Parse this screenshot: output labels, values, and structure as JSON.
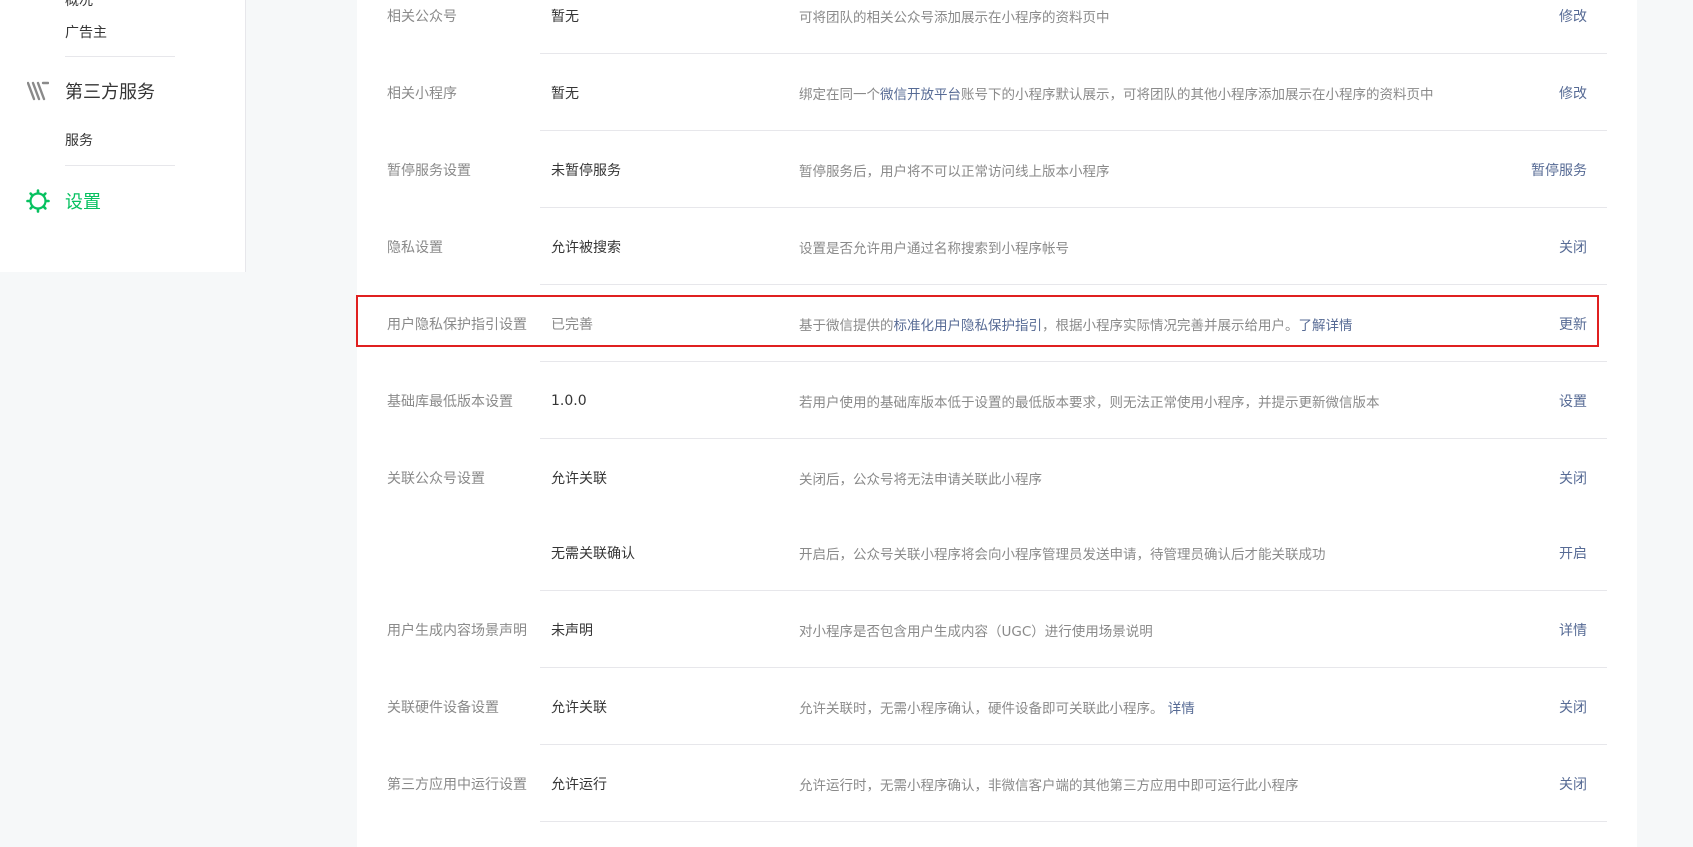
{
  "sidebar": {
    "partial_top": "概况",
    "ad_item": "广告主",
    "third_party_group": "第三方服务",
    "service_item": "服务",
    "settings_group": "设置"
  },
  "rows": [
    {
      "name": "相关公众号",
      "value": "暂无",
      "desc": "可将团队的相关公众号添加展示在小程序的资料页中",
      "action": "修改"
    },
    {
      "name": "相关小程序",
      "value": "暂无",
      "desc_pre": "绑定在同一个",
      "desc_link": "微信开放平台",
      "desc_post": "账号下的小程序默认展示，可将团队的其他小程序添加展示在小程序的资料页中",
      "action": "修改"
    },
    {
      "name": "暂停服务设置",
      "value": "未暂停服务",
      "desc": "暂停服务后，用户将不可以正常访问线上版本小程序",
      "action": "暂停服务"
    },
    {
      "name": "隐私设置",
      "value": "允许被搜索",
      "desc": "设置是否允许用户通过名称搜索到小程序帐号",
      "action": "关闭"
    },
    {
      "name": "用户隐私保护指引设置",
      "value": "已完善",
      "desc_pre": "基于微信提供的",
      "desc_link": "标准化用户隐私保护指引",
      "desc_mid": "，根据小程序实际情况完善并展示给用户。",
      "desc_link2": "了解详情",
      "action": "更新"
    },
    {
      "name": "基础库最低版本设置",
      "value": "1.0.0",
      "desc": "若用户使用的基础库版本低于设置的最低版本要求，则无法正常使用小程序，并提示更新微信版本",
      "action": "设置"
    },
    {
      "name": "关联公众号设置",
      "value": "允许关联",
      "desc": "关闭后，公众号将无法申请关联此小程序",
      "action": "关闭"
    },
    {
      "name": "",
      "value": "无需关联确认",
      "desc": "开启后，公众号关联小程序将会向小程序管理员发送申请，待管理员确认后才能关联成功",
      "action": "开启"
    },
    {
      "name": "用户生成内容场景声明",
      "value": "未声明",
      "desc": "对小程序是否包含用户生成内容（UGC）进行使用场景说明",
      "action": "详情"
    },
    {
      "name": "关联硬件设备设置",
      "value": "允许关联",
      "desc_pre": "允许关联时，无需小程序确认，硬件设备即可关联此小程序。 ",
      "desc_link": "详情",
      "action": "关闭"
    },
    {
      "name": "第三方应用中运行设置",
      "value": "允许运行",
      "desc": "允许运行时，无需小程序确认，非微信客户端的其他第三方应用中即可运行此小程序",
      "action": "关闭"
    }
  ]
}
